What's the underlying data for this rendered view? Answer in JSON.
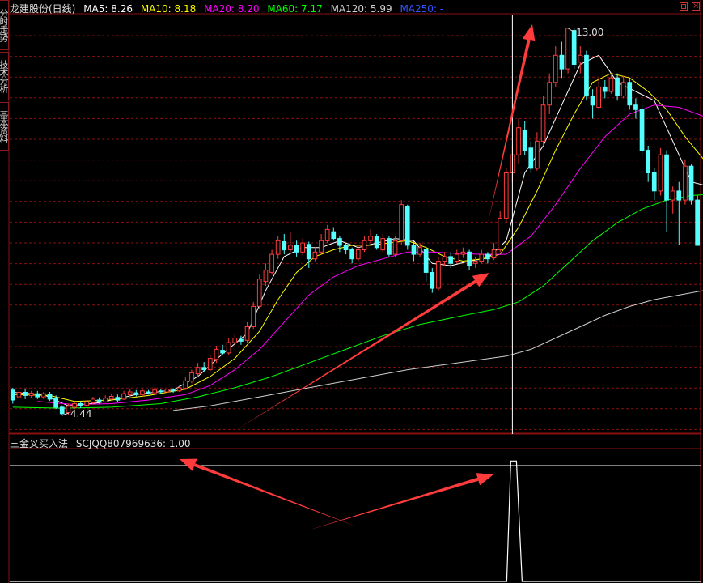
{
  "header": {
    "stock_name": "龙建股份(日线)",
    "ma_legend": [
      {
        "label": "MA5: 8.26",
        "color": "#ffffff"
      },
      {
        "label": "MA10: 8.18",
        "color": "#ffff00"
      },
      {
        "label": "MA20: 8.20",
        "color": "#ff00ff"
      },
      {
        "label": "MA60: 7.17",
        "color": "#00ff00"
      },
      {
        "label": "MA120: 5.99",
        "color": "#cfcfcf"
      },
      {
        "label": "MA250: -",
        "color": "#3355ff"
      }
    ]
  },
  "side_tabs": [
    "分时走势",
    "技术分析",
    "基本资料"
  ],
  "indicator": {
    "name": "三金叉买入法",
    "value_label": "SCJQQ807969636: 1.00"
  },
  "annotations": {
    "high_label": "13.00",
    "low_label": "4.44"
  },
  "colors": {
    "up": "#ff3b3b",
    "down": "#54ffff",
    "grid": "#8a1010",
    "arrow": "#ff3b3b",
    "ma5": "#ffffff",
    "ma10": "#ffff00",
    "ma20": "#ff00ff",
    "ma60": "#00ff00",
    "ma120": "#cfcfcf"
  },
  "chart_data": {
    "type": "candlestick",
    "price_range": [
      4.1,
      13.3
    ],
    "candles": [
      {
        "o": 5.0,
        "c": 4.78,
        "h": 5.05,
        "l": 4.7
      },
      {
        "o": 4.85,
        "c": 4.95,
        "h": 5.0,
        "l": 4.8
      },
      {
        "o": 4.95,
        "c": 4.88,
        "h": 5.02,
        "l": 4.8
      },
      {
        "o": 4.88,
        "c": 4.93,
        "h": 4.98,
        "l": 4.82
      },
      {
        "o": 4.92,
        "c": 4.85,
        "h": 4.98,
        "l": 4.8
      },
      {
        "o": 4.85,
        "c": 4.92,
        "h": 4.96,
        "l": 4.8
      },
      {
        "o": 4.9,
        "c": 4.8,
        "h": 4.96,
        "l": 4.76
      },
      {
        "o": 4.82,
        "c": 4.62,
        "h": 4.88,
        "l": 4.58
      },
      {
        "o": 4.62,
        "c": 4.48,
        "h": 4.66,
        "l": 4.44
      },
      {
        "o": 4.5,
        "c": 4.64,
        "h": 4.7,
        "l": 4.46
      },
      {
        "o": 4.62,
        "c": 4.7,
        "h": 4.74,
        "l": 4.58
      },
      {
        "o": 4.7,
        "c": 4.66,
        "h": 4.75,
        "l": 4.6
      },
      {
        "o": 4.66,
        "c": 4.74,
        "h": 4.78,
        "l": 4.62
      },
      {
        "o": 4.72,
        "c": 4.8,
        "h": 4.85,
        "l": 4.68
      },
      {
        "o": 4.78,
        "c": 4.74,
        "h": 4.84,
        "l": 4.7
      },
      {
        "o": 4.74,
        "c": 4.82,
        "h": 4.88,
        "l": 4.72
      },
      {
        "o": 4.8,
        "c": 4.86,
        "h": 4.92,
        "l": 4.76
      },
      {
        "o": 4.84,
        "c": 4.78,
        "h": 4.9,
        "l": 4.74
      },
      {
        "o": 4.8,
        "c": 4.92,
        "h": 4.98,
        "l": 4.78
      },
      {
        "o": 4.9,
        "c": 4.96,
        "h": 5.02,
        "l": 4.86
      },
      {
        "o": 4.94,
        "c": 4.9,
        "h": 5.0,
        "l": 4.86
      },
      {
        "o": 4.9,
        "c": 4.98,
        "h": 5.04,
        "l": 4.86
      },
      {
        "o": 4.96,
        "c": 4.94,
        "h": 5.0,
        "l": 4.9
      },
      {
        "o": 4.94,
        "c": 5.0,
        "h": 5.06,
        "l": 4.9
      },
      {
        "o": 4.98,
        "c": 4.96,
        "h": 5.02,
        "l": 4.92
      },
      {
        "o": 4.96,
        "c": 5.02,
        "h": 5.08,
        "l": 4.94
      },
      {
        "o": 5.0,
        "c": 4.98,
        "h": 5.04,
        "l": 4.94
      },
      {
        "o": 4.98,
        "c": 5.05,
        "h": 5.12,
        "l": 4.96
      },
      {
        "o": 5.04,
        "c": 5.2,
        "h": 5.28,
        "l": 5.0
      },
      {
        "o": 5.2,
        "c": 5.38,
        "h": 5.45,
        "l": 5.15
      },
      {
        "o": 5.36,
        "c": 5.5,
        "h": 5.6,
        "l": 5.3
      },
      {
        "o": 5.5,
        "c": 5.45,
        "h": 5.62,
        "l": 5.4
      },
      {
        "o": 5.45,
        "c": 5.7,
        "h": 5.78,
        "l": 5.42
      },
      {
        "o": 5.68,
        "c": 5.9,
        "h": 5.98,
        "l": 5.6
      },
      {
        "o": 5.88,
        "c": 5.82,
        "h": 6.0,
        "l": 5.78
      },
      {
        "o": 5.82,
        "c": 6.05,
        "h": 6.15,
        "l": 5.78
      },
      {
        "o": 6.05,
        "c": 6.15,
        "h": 6.25,
        "l": 6.0
      },
      {
        "o": 6.12,
        "c": 6.08,
        "h": 6.2,
        "l": 6.0
      },
      {
        "o": 6.1,
        "c": 6.4,
        "h": 6.5,
        "l": 6.05
      },
      {
        "o": 6.4,
        "c": 6.85,
        "h": 6.95,
        "l": 6.35
      },
      {
        "o": 6.85,
        "c": 7.45,
        "h": 7.55,
        "l": 6.8
      },
      {
        "o": 7.4,
        "c": 7.65,
        "h": 7.8,
        "l": 7.3
      },
      {
        "o": 7.6,
        "c": 8.0,
        "h": 8.1,
        "l": 7.55
      },
      {
        "o": 8.0,
        "c": 8.3,
        "h": 8.4,
        "l": 7.9
      },
      {
        "o": 8.28,
        "c": 8.1,
        "h": 8.45,
        "l": 8.0
      },
      {
        "o": 8.1,
        "c": 8.2,
        "h": 8.5,
        "l": 8.05
      },
      {
        "o": 8.2,
        "c": 8.05,
        "h": 8.3,
        "l": 7.95
      },
      {
        "o": 8.05,
        "c": 8.25,
        "h": 8.35,
        "l": 7.98
      },
      {
        "o": 8.22,
        "c": 7.9,
        "h": 8.28,
        "l": 7.7
      },
      {
        "o": 7.9,
        "c": 8.05,
        "h": 8.15,
        "l": 7.85
      },
      {
        "o": 8.05,
        "c": 8.3,
        "h": 8.45,
        "l": 8.0
      },
      {
        "o": 8.3,
        "c": 8.55,
        "h": 8.65,
        "l": 8.25
      },
      {
        "o": 8.5,
        "c": 8.35,
        "h": 8.6,
        "l": 8.3
      },
      {
        "o": 8.35,
        "c": 8.2,
        "h": 8.4,
        "l": 8.05
      },
      {
        "o": 8.2,
        "c": 8.1,
        "h": 8.25,
        "l": 8.0
      },
      {
        "o": 8.1,
        "c": 7.9,
        "h": 8.15,
        "l": 7.8
      },
      {
        "o": 7.9,
        "c": 8.1,
        "h": 8.2,
        "l": 7.85
      },
      {
        "o": 8.1,
        "c": 8.3,
        "h": 8.4,
        "l": 8.05
      },
      {
        "o": 8.3,
        "c": 8.4,
        "h": 8.55,
        "l": 8.25
      },
      {
        "o": 8.4,
        "c": 8.15,
        "h": 8.45,
        "l": 8.1
      },
      {
        "o": 8.1,
        "c": 8.35,
        "h": 8.45,
        "l": 8.05
      },
      {
        "o": 8.35,
        "c": 8.0,
        "h": 8.4,
        "l": 7.95
      },
      {
        "o": 8.0,
        "c": 8.3,
        "h": 8.4,
        "l": 7.95
      },
      {
        "o": 8.3,
        "c": 9.1,
        "h": 9.2,
        "l": 8.2
      },
      {
        "o": 9.05,
        "c": 8.2,
        "h": 9.1,
        "l": 8.1
      },
      {
        "o": 8.2,
        "c": 8.0,
        "h": 8.3,
        "l": 7.85
      },
      {
        "o": 8.0,
        "c": 8.15,
        "h": 8.25,
        "l": 7.95
      },
      {
        "o": 8.1,
        "c": 7.6,
        "h": 8.15,
        "l": 7.4
      },
      {
        "o": 7.6,
        "c": 7.25,
        "h": 7.7,
        "l": 7.15
      },
      {
        "o": 7.25,
        "c": 7.85,
        "h": 7.95,
        "l": 7.2
      },
      {
        "o": 7.85,
        "c": 7.95,
        "h": 8.05,
        "l": 7.75
      },
      {
        "o": 7.95,
        "c": 7.8,
        "h": 8.05,
        "l": 7.7
      },
      {
        "o": 7.85,
        "c": 8.0,
        "h": 8.1,
        "l": 7.8
      },
      {
        "o": 8.0,
        "c": 8.05,
        "h": 8.15,
        "l": 7.92
      },
      {
        "o": 8.05,
        "c": 7.75,
        "h": 8.1,
        "l": 7.65
      },
      {
        "o": 7.8,
        "c": 7.85,
        "h": 7.95,
        "l": 7.7
      },
      {
        "o": 7.85,
        "c": 8.0,
        "h": 8.1,
        "l": 7.8
      },
      {
        "o": 8.0,
        "c": 7.9,
        "h": 8.05,
        "l": 7.8
      },
      {
        "o": 7.92,
        "c": 8.1,
        "h": 8.25,
        "l": 7.88
      },
      {
        "o": 8.1,
        "c": 8.8,
        "h": 8.95,
        "l": 8.05
      },
      {
        "o": 8.8,
        "c": 9.8,
        "h": 9.9,
        "l": 8.7
      },
      {
        "o": 9.8,
        "c": 10.2,
        "h": 10.4,
        "l": 9.6
      },
      {
        "o": 10.2,
        "c": 10.8,
        "h": 11.0,
        "l": 10.0
      },
      {
        "o": 10.75,
        "c": 10.3,
        "h": 10.95,
        "l": 10.2
      },
      {
        "o": 10.35,
        "c": 9.9,
        "h": 10.5,
        "l": 9.8
      },
      {
        "o": 9.9,
        "c": 10.5,
        "h": 10.7,
        "l": 9.85
      },
      {
        "o": 10.5,
        "c": 11.3,
        "h": 11.5,
        "l": 10.4
      },
      {
        "o": 11.3,
        "c": 11.8,
        "h": 12.0,
        "l": 11.1
      },
      {
        "o": 11.8,
        "c": 12.4,
        "h": 12.6,
        "l": 11.7
      },
      {
        "o": 12.4,
        "c": 12.1,
        "h": 12.7,
        "l": 11.9
      },
      {
        "o": 12.1,
        "c": 13.0,
        "h": 13.0,
        "l": 12.0
      },
      {
        "o": 12.95,
        "c": 12.2,
        "h": 13.0,
        "l": 12.1
      },
      {
        "o": 12.25,
        "c": 12.4,
        "h": 12.6,
        "l": 12.0
      },
      {
        "o": 12.4,
        "c": 11.5,
        "h": 12.5,
        "l": 11.4
      },
      {
        "o": 11.5,
        "c": 11.3,
        "h": 11.65,
        "l": 11.0
      },
      {
        "o": 11.25,
        "c": 11.7,
        "h": 11.9,
        "l": 11.2
      },
      {
        "o": 11.7,
        "c": 11.6,
        "h": 11.85,
        "l": 11.45
      },
      {
        "o": 11.6,
        "c": 11.9,
        "h": 12.0,
        "l": 11.55
      },
      {
        "o": 11.9,
        "c": 11.5,
        "h": 12.0,
        "l": 11.4
      },
      {
        "o": 11.5,
        "c": 11.8,
        "h": 11.95,
        "l": 11.45
      },
      {
        "o": 11.8,
        "c": 11.3,
        "h": 11.9,
        "l": 11.2
      },
      {
        "o": 11.3,
        "c": 11.2,
        "h": 11.45,
        "l": 11.0
      },
      {
        "o": 11.2,
        "c": 10.3,
        "h": 11.3,
        "l": 10.2
      },
      {
        "o": 10.3,
        "c": 9.8,
        "h": 10.4,
        "l": 9.6
      },
      {
        "o": 9.8,
        "c": 9.4,
        "h": 9.9,
        "l": 9.2
      },
      {
        "o": 9.4,
        "c": 10.2,
        "h": 10.35,
        "l": 9.3
      },
      {
        "o": 10.2,
        "c": 9.2,
        "h": 10.3,
        "l": 8.5
      },
      {
        "o": 9.2,
        "c": 9.4,
        "h": 9.5,
        "l": 8.9
      },
      {
        "o": 9.4,
        "c": 9.2,
        "h": 9.6,
        "l": 8.2
      },
      {
        "o": 9.2,
        "c": 9.95,
        "h": 10.1,
        "l": 9.1
      },
      {
        "o": 9.95,
        "c": 9.2,
        "h": 10.0,
        "l": 9.1
      },
      {
        "o": 9.2,
        "c": 8.2,
        "h": 9.3,
        "l": 8.2
      }
    ],
    "ma_lines": {
      "ma5": [
        [
          0,
          4.95
        ],
        [
          5,
          4.9
        ],
        [
          9,
          4.65
        ],
        [
          14,
          4.72
        ],
        [
          20,
          4.9
        ],
        [
          26,
          5.0
        ],
        [
          30,
          5.3
        ],
        [
          34,
          5.8
        ],
        [
          38,
          6.25
        ],
        [
          41,
          7.2
        ],
        [
          44,
          7.95
        ],
        [
          47,
          8.15
        ],
        [
          50,
          8.15
        ],
        [
          53,
          8.3
        ],
        [
          56,
          8.15
        ],
        [
          59,
          8.25
        ],
        [
          62,
          8.35
        ],
        [
          65,
          8.3
        ],
        [
          68,
          7.8
        ],
        [
          71,
          7.75
        ],
        [
          74,
          7.85
        ],
        [
          77,
          7.92
        ],
        [
          80,
          8.3
        ],
        [
          83,
          9.8
        ],
        [
          86,
          10.4
        ],
        [
          89,
          11.3
        ],
        [
          92,
          12.2
        ],
        [
          95,
          12.4
        ],
        [
          98,
          11.8
        ],
        [
          101,
          11.6
        ],
        [
          104,
          11.4
        ],
        [
          107,
          10.5
        ],
        [
          110,
          9.6
        ],
        [
          113,
          9.5
        ],
        [
          115,
          9.2
        ]
      ],
      "ma10": [
        [
          0,
          4.9
        ],
        [
          6,
          4.88
        ],
        [
          10,
          4.75
        ],
        [
          16,
          4.78
        ],
        [
          22,
          4.88
        ],
        [
          28,
          5.02
        ],
        [
          32,
          5.3
        ],
        [
          36,
          5.7
        ],
        [
          40,
          6.3
        ],
        [
          43,
          7.0
        ],
        [
          46,
          7.6
        ],
        [
          49,
          7.95
        ],
        [
          52,
          8.1
        ],
        [
          55,
          8.2
        ],
        [
          58,
          8.2
        ],
        [
          61,
          8.25
        ],
        [
          64,
          8.3
        ],
        [
          67,
          8.15
        ],
        [
          70,
          7.95
        ],
        [
          73,
          7.85
        ],
        [
          76,
          7.9
        ],
        [
          79,
          8.0
        ],
        [
          82,
          8.6
        ],
        [
          85,
          9.4
        ],
        [
          88,
          10.3
        ],
        [
          91,
          11.1
        ],
        [
          94,
          11.8
        ],
        [
          97,
          12.0
        ],
        [
          100,
          11.9
        ],
        [
          103,
          11.6
        ],
        [
          106,
          11.2
        ],
        [
          109,
          10.6
        ],
        [
          112,
          10.1
        ],
        [
          115,
          9.7
        ]
      ],
      "ma20": [
        [
          4,
          4.75
        ],
        [
          10,
          4.68
        ],
        [
          16,
          4.7
        ],
        [
          22,
          4.78
        ],
        [
          28,
          4.9
        ],
        [
          32,
          5.1
        ],
        [
          36,
          5.45
        ],
        [
          40,
          5.9
        ],
        [
          44,
          6.5
        ],
        [
          48,
          7.1
        ],
        [
          52,
          7.5
        ],
        [
          56,
          7.75
        ],
        [
          60,
          7.9
        ],
        [
          64,
          8.05
        ],
        [
          68,
          8.05
        ],
        [
          72,
          8.02
        ],
        [
          76,
          8.0
        ],
        [
          80,
          8.0
        ],
        [
          84,
          8.4
        ],
        [
          88,
          9.1
        ],
        [
          92,
          9.9
        ],
        [
          96,
          10.6
        ],
        [
          100,
          11.1
        ],
        [
          104,
          11.3
        ],
        [
          108,
          11.25
        ],
        [
          112,
          11.05
        ],
        [
          115,
          10.75
        ]
      ],
      "ma60": [
        [
          0,
          4.62
        ],
        [
          8,
          4.6
        ],
        [
          16,
          4.62
        ],
        [
          24,
          4.7
        ],
        [
          30,
          4.85
        ],
        [
          36,
          5.05
        ],
        [
          42,
          5.3
        ],
        [
          48,
          5.6
        ],
        [
          54,
          5.9
        ],
        [
          60,
          6.2
        ],
        [
          66,
          6.45
        ],
        [
          72,
          6.62
        ],
        [
          78,
          6.78
        ],
        [
          82,
          6.95
        ],
        [
          86,
          7.3
        ],
        [
          90,
          7.8
        ],
        [
          94,
          8.3
        ],
        [
          98,
          8.7
        ],
        [
          102,
          9.0
        ],
        [
          106,
          9.2
        ],
        [
          110,
          9.3
        ],
        [
          115,
          9.35
        ]
      ],
      "ma120": [
        [
          26,
          4.55
        ],
        [
          32,
          4.65
        ],
        [
          40,
          4.85
        ],
        [
          48,
          5.05
        ],
        [
          56,
          5.25
        ],
        [
          64,
          5.45
        ],
        [
          72,
          5.6
        ],
        [
          80,
          5.75
        ],
        [
          84,
          5.9
        ],
        [
          88,
          6.15
        ],
        [
          92,
          6.4
        ],
        [
          96,
          6.65
        ],
        [
          100,
          6.85
        ],
        [
          104,
          7.0
        ],
        [
          108,
          7.1
        ],
        [
          112,
          7.2
        ],
        [
          115,
          7.25
        ]
      ]
    },
    "indicator_series": {
      "name": "SCJQQ807969636",
      "range": [
        0,
        1
      ],
      "signal_index": 81
    }
  }
}
